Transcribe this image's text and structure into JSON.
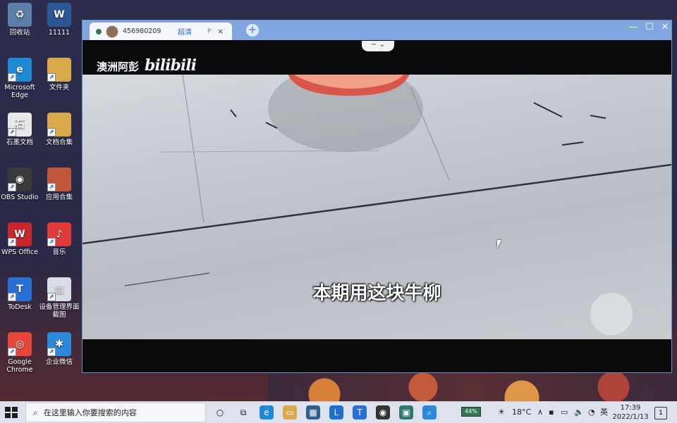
{
  "desktop": {
    "icons": [
      {
        "label": "回收站",
        "icon": "recycle-bin-icon",
        "glyph": "♻"
      },
      {
        "label": "11111",
        "icon": "word-document-icon",
        "glyph": "W"
      },
      {
        "label": "Microsoft Edge",
        "icon": "edge-icon",
        "glyph": "e"
      },
      {
        "label": "文件夹",
        "icon": "folder-icon",
        "glyph": ""
      },
      {
        "label": "石墨文档",
        "icon": "shimo-docs-icon",
        "glyph": "石"
      },
      {
        "label": "文档合集",
        "icon": "document-collection-icon",
        "glyph": ""
      },
      {
        "label": "OBS Studio",
        "icon": "obs-studio-icon",
        "glyph": "◉"
      },
      {
        "label": "应用合集",
        "icon": "app-collection-icon",
        "glyph": ""
      },
      {
        "label": "WPS Office",
        "icon": "wps-office-icon",
        "glyph": "W"
      },
      {
        "label": "音乐",
        "icon": "music-icon",
        "glyph": "♪"
      },
      {
        "label": "ToDesk",
        "icon": "todesk-icon",
        "glyph": "T"
      },
      {
        "label": "设备管理界面截图",
        "icon": "screenshot-file-icon",
        "glyph": "▤"
      },
      {
        "label": "Google Chrome",
        "icon": "chrome-icon",
        "glyph": "◎"
      },
      {
        "label": "企业微信",
        "icon": "wecom-icon",
        "glyph": "✱"
      }
    ],
    "icon_colors": [
      "#5b7fa8",
      "#2b5797",
      "#1f8ad3",
      "#d9a84a",
      "#e8e8e8",
      "#d9a84a",
      "#3a3a3a",
      "#c0563a",
      "#c8262c",
      "#e03a3a",
      "#2a6fd6",
      "#d8dde6",
      "#e8463a",
      "#2a89d8"
    ]
  },
  "player": {
    "tab": {
      "uid": "456980209",
      "quality": "超清",
      "extra": "P",
      "close": "×"
    },
    "new_tab": "+",
    "controls": {
      "minimize": "—",
      "maximize": "☐",
      "close": "✕"
    },
    "pull_tab": "− ⌄",
    "brand": {
      "channel": "澳洲阿彭",
      "logo": "bilibili"
    },
    "subtitle": "本期用这块牛柳"
  },
  "taskbar": {
    "search_placeholder": "在这里输入你要搜索的内容",
    "apps": [
      {
        "icon": "cortana-icon",
        "glyph": "○",
        "color": "#222222"
      },
      {
        "icon": "task-view-icon",
        "glyph": "⧉",
        "color": "#222222"
      },
      {
        "icon": "edge-icon",
        "glyph": "e",
        "color": "#1f8ad3"
      },
      {
        "icon": "file-explorer-icon",
        "glyph": "▭",
        "color": "#d9a84a"
      },
      {
        "icon": "app-icon",
        "glyph": "▦",
        "color": "#2f5e8f"
      },
      {
        "icon": "l-app-icon",
        "glyph": "L",
        "color": "#1f6fd1"
      },
      {
        "icon": "todesk-icon",
        "glyph": "T",
        "color": "#2a6fd6"
      },
      {
        "icon": "obs-studio-icon",
        "glyph": "◉",
        "color": "#333333"
      },
      {
        "icon": "capture-app-icon",
        "glyph": "▣",
        "color": "#2f7a6a"
      },
      {
        "icon": "search-app-icon",
        "glyph": "⌕",
        "color": "#2a89d8"
      }
    ],
    "battery": "44%",
    "weather": "18°C",
    "ime": "英",
    "time": "17:39",
    "date": "2022/1/13",
    "notifications": "1"
  }
}
